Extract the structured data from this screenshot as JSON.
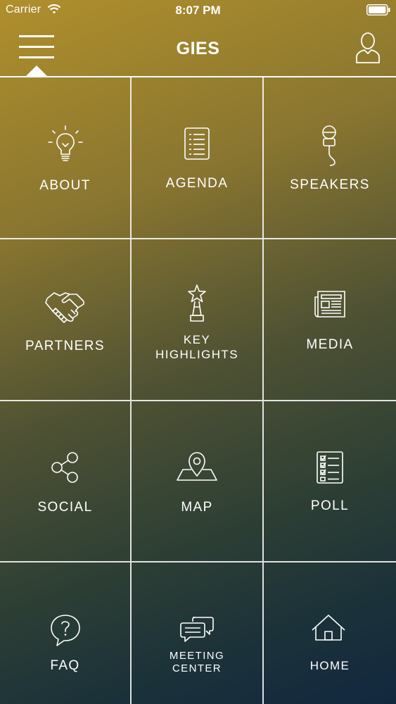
{
  "status_bar": {
    "carrier": "Carrier",
    "time": "8:07 PM"
  },
  "header": {
    "title": "GIES",
    "menu_icon": "hamburger-menu-icon",
    "profile_icon": "user-profile-icon"
  },
  "tiles": [
    {
      "label": "ABOUT",
      "icon": "lightbulb-icon"
    },
    {
      "label": "AGENDA",
      "icon": "document-list-icon"
    },
    {
      "label": "SPEAKERS",
      "icon": "microphone-icon"
    },
    {
      "label": "PARTNERS",
      "icon": "handshake-icon"
    },
    {
      "label": "KEY\nHIGHLIGHTS",
      "icon": "star-trophy-icon"
    },
    {
      "label": "MEDIA",
      "icon": "newspaper-icon"
    },
    {
      "label": "SOCIAL",
      "icon": "share-icon"
    },
    {
      "label": "MAP",
      "icon": "map-pin-icon"
    },
    {
      "label": "POLL",
      "icon": "checklist-icon"
    },
    {
      "label": "FAQ",
      "icon": "question-bubble-icon"
    },
    {
      "label": "MEETING\nCENTER",
      "icon": "chat-bubbles-icon"
    },
    {
      "label": "HOME",
      "icon": "home-icon"
    }
  ],
  "colors": {
    "gradient_top": "#b08f2c",
    "gradient_bottom": "#12283f",
    "foreground": "#ffffff"
  }
}
